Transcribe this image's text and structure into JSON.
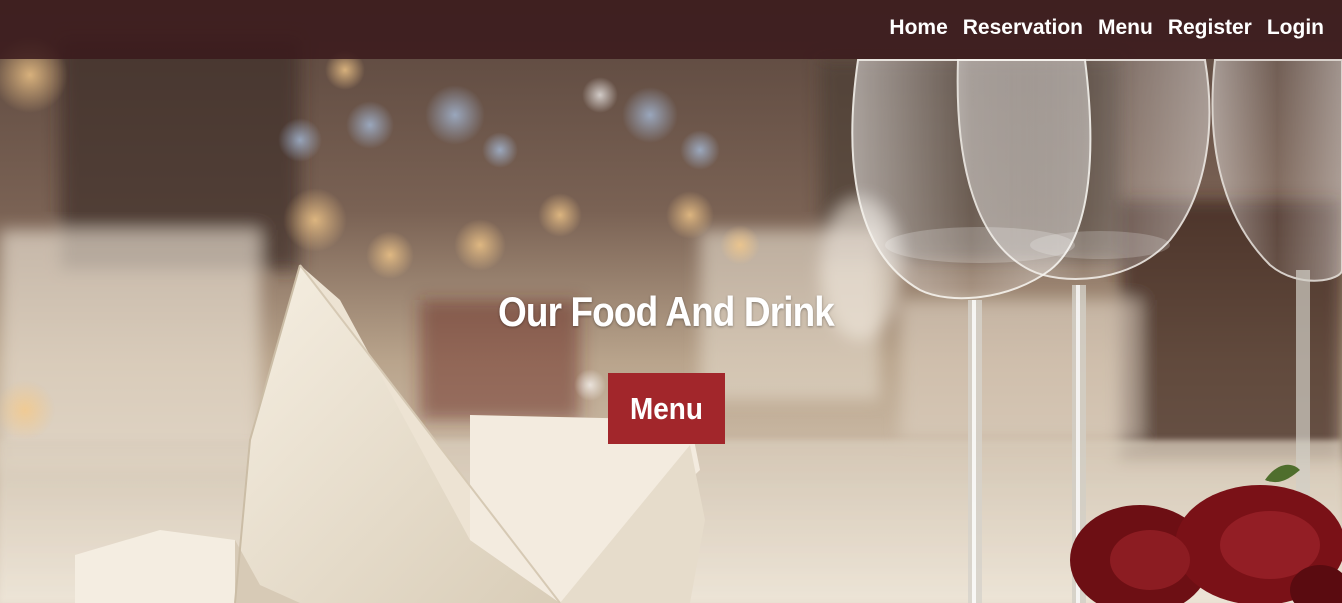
{
  "nav": {
    "items": [
      {
        "label": "Home"
      },
      {
        "label": "Reservation"
      },
      {
        "label": "Menu"
      },
      {
        "label": "Register"
      },
      {
        "label": "Login"
      }
    ]
  },
  "hero": {
    "title": "Our Food And Drink",
    "button_label": "Menu",
    "button_color": "#a2262b",
    "navbar_color": "#3a1a1c",
    "background_image": "restaurant-table-wine-glasses-napkin-roses"
  }
}
